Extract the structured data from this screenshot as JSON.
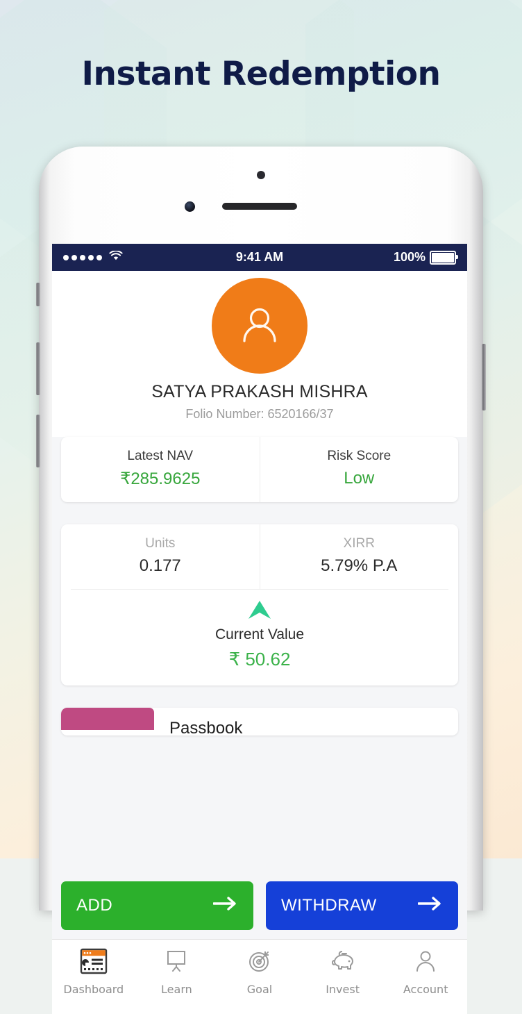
{
  "headline": "Instant Redemption",
  "status_bar": {
    "signal_icon": "signal-dots-icon",
    "wifi_icon": "wifi-icon",
    "time": "9:41 AM",
    "battery_percent": "100%",
    "battery_icon": "battery-icon",
    "background_color": "#1a2352"
  },
  "profile": {
    "avatar_icon": "person-avatar-icon",
    "avatar_color": "#f07c18",
    "name": "SATYA PRAKASH MISHRA",
    "folio": "Folio Number: 6520166/37"
  },
  "stats_card_one": [
    {
      "label": "Latest NAV",
      "value": "₹285.9625",
      "value_color": "#37a63c"
    },
    {
      "label": "Risk Score",
      "value": "Low",
      "value_color": "#37a63c"
    }
  ],
  "stats_card_two": [
    {
      "label": "Units",
      "value": "0.177",
      "value_color": "#2b2b2b"
    },
    {
      "label": "XIRR",
      "value": "5.79% P.A",
      "value_color": "#2b2b2b"
    }
  ],
  "current_value": {
    "trend_icon": "up-arrow-icon",
    "trend_color": "#2ecc8f",
    "label": "Current Value",
    "value": "₹ 50.62",
    "value_color": "#3bb24a"
  },
  "passbook": {
    "tab_color": "#bf4a82",
    "label": "Passbook"
  },
  "actions": [
    {
      "label": "ADD",
      "icon": "arrow-right-icon",
      "color": "#2cb02c"
    },
    {
      "label": "WITHDRAW",
      "icon": "arrow-right-icon",
      "color": "#1540d8"
    }
  ],
  "bottom_nav": [
    {
      "label": "Dashboard",
      "icon": "dashboard-icon",
      "active": true
    },
    {
      "label": "Learn",
      "icon": "presentation-board-icon",
      "active": false
    },
    {
      "label": "Goal",
      "icon": "target-icon",
      "active": false
    },
    {
      "label": "Invest",
      "icon": "piggy-bank-icon",
      "active": false
    },
    {
      "label": "Account",
      "icon": "person-icon",
      "active": false
    }
  ]
}
